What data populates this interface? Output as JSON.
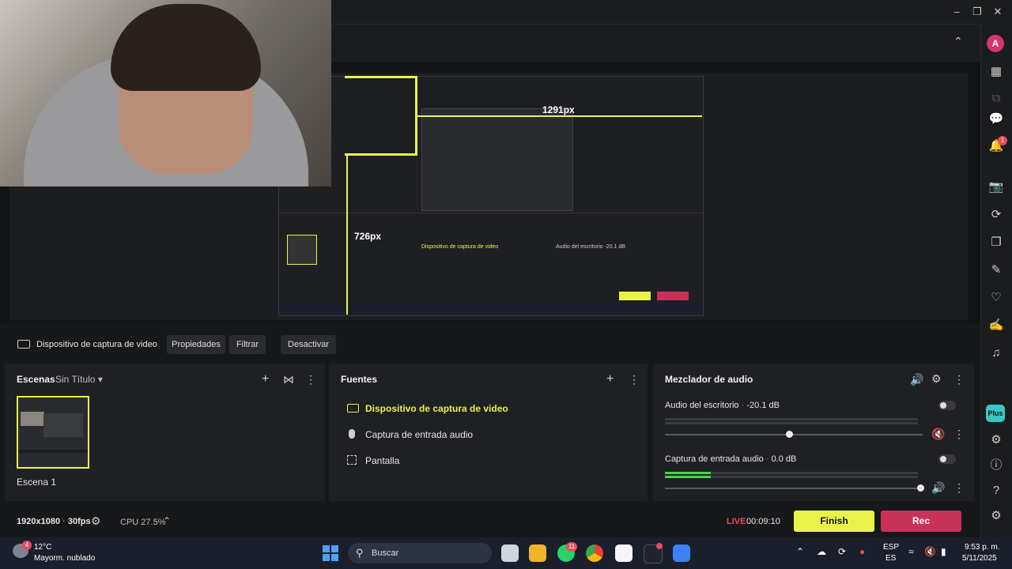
{
  "window": {
    "minimize_icon": "minimize-icon",
    "maximize_icon": "restore-icon",
    "close_icon": "close-icon"
  },
  "preview": {
    "overlay_label_1": "1291px",
    "overlay_label_2": "726px"
  },
  "source_toolbar": {
    "device_name": "Dispositivo de captura de video",
    "properties": "Propiedades",
    "filter": "Filtrar",
    "deactivate": "Desactivar"
  },
  "scenes": {
    "title": "Escenas",
    "collection": "Sin Título",
    "items": [
      {
        "label": "Escena 1"
      }
    ]
  },
  "sources": {
    "title": "Fuentes",
    "items": [
      {
        "label": "Dispositivo de captura de video",
        "icon": "camera-icon",
        "active": true
      },
      {
        "label": "Captura de entrada audio",
        "icon": "microphone-icon",
        "active": false
      },
      {
        "label": "Pantalla",
        "icon": "screen-capture-icon",
        "active": false
      }
    ]
  },
  "mixer": {
    "title": "Mezclador de audio",
    "channels": [
      {
        "name": "Audio del escritorio",
        "level": "-20.1 dB",
        "volume": 0.48,
        "muted": true
      },
      {
        "name": "Captura de entrada audio",
        "level": "0.0 dB",
        "volume": 0.99,
        "muted": false
      }
    ]
  },
  "status": {
    "resolution": "1920x1080",
    "fps": "30fps",
    "cpu": "CPU 27.5%",
    "live_label": "LIVE",
    "live_time": "00:09:10",
    "finish": "Finish",
    "rec": "Rec"
  },
  "sidebar": {
    "avatar_letter": "A",
    "notifications": "1",
    "plus_label": "Plus"
  },
  "taskbar": {
    "weather_temp": "12°C",
    "weather_desc": "Mayorm. nublado",
    "weather_badge": "4",
    "search": "Buscar",
    "whatsapp_badge": "11",
    "lang_1": "ESP",
    "lang_2": "ES",
    "time": "9:53 p. m.",
    "date": "5/11/2025"
  },
  "colors": {
    "accent_yellow": "#e8f34a",
    "rec_red": "#c8325a",
    "live_red": "#e84a5f"
  }
}
